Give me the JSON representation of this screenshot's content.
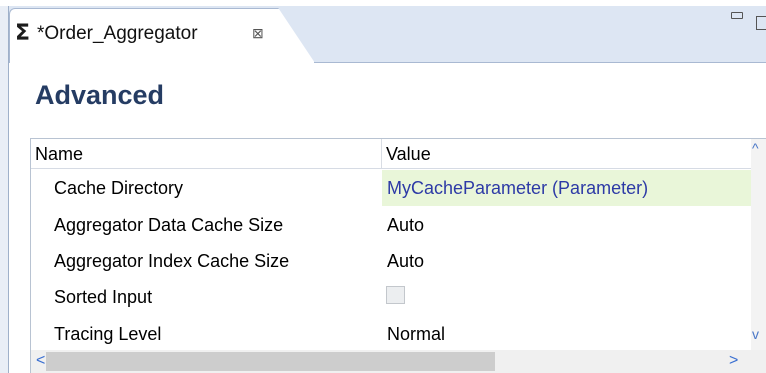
{
  "editor_tab": {
    "icon": "sigma-icon",
    "title": "*Order_Aggregator",
    "close_glyph": "⊠"
  },
  "section": {
    "title": "Advanced"
  },
  "table": {
    "headers": {
      "name": "Name",
      "value": "Value"
    },
    "rows": [
      {
        "name": "Cache Directory",
        "value": "MyCacheParameter (Parameter)",
        "highlighted": true
      },
      {
        "name": "Aggregator Data Cache Size",
        "value": "Auto"
      },
      {
        "name": "Aggregator Index Cache Size",
        "value": "Auto"
      },
      {
        "name": "Sorted Input",
        "value_type": "checkbox",
        "checked": false
      },
      {
        "name": "Tracing Level",
        "value": "Normal"
      }
    ]
  },
  "scrollbars": {
    "up": "^",
    "down": "v",
    "left": "<",
    "right": ">"
  },
  "colors": {
    "section_title": "#253c63",
    "parameter_value": "#2d3aa6",
    "highlight_row": "#e9f6d9",
    "tab_bar": "#dde6f3"
  }
}
